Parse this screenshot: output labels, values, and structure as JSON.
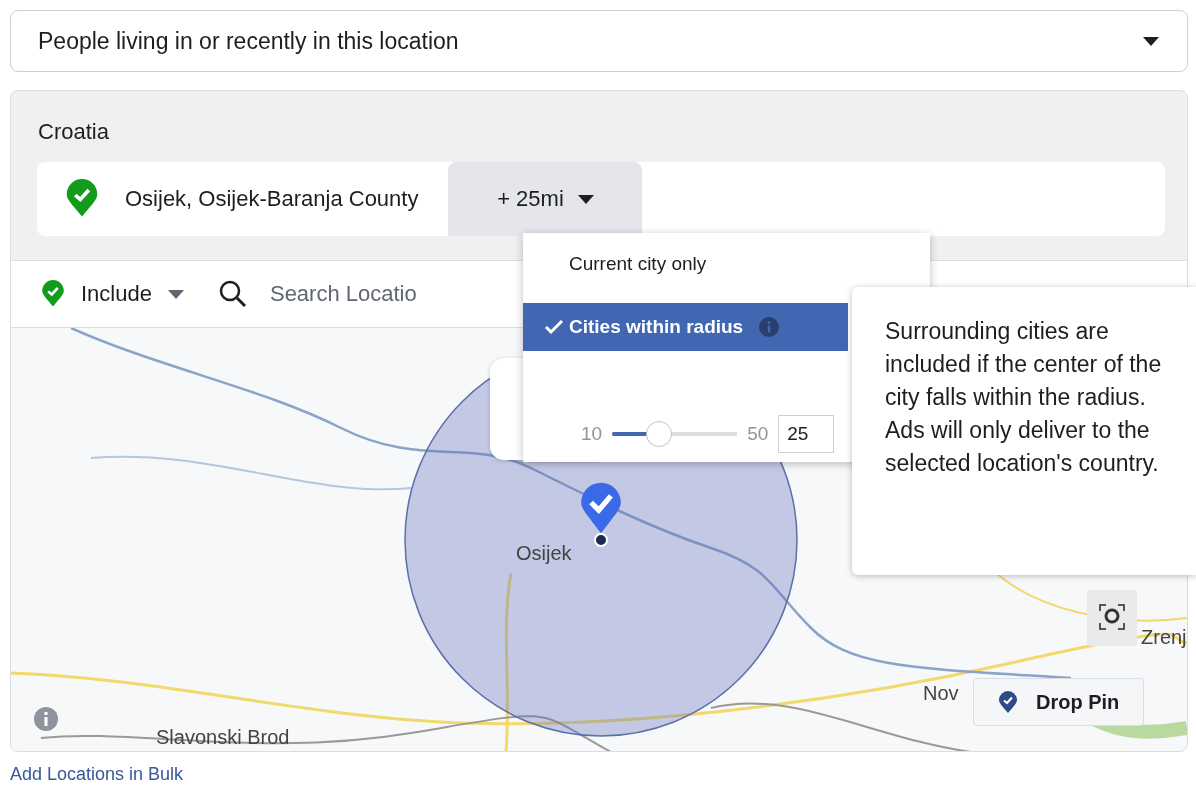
{
  "audience_select": {
    "value": "People living in or recently in this location"
  },
  "country": "Croatia",
  "location": {
    "name": "Osijek, Osijek-Baranja County",
    "radius": "+ 25mi"
  },
  "include": {
    "label": "Include"
  },
  "search": {
    "placeholder": "Search Locatio"
  },
  "radius_menu": {
    "options": [
      {
        "label": "Current city only",
        "selected": false
      },
      {
        "label": "Cities within radius",
        "selected": true
      }
    ],
    "slider": {
      "min": "10",
      "max": "50",
      "level": 0.375
    },
    "value": "25"
  },
  "tooltip": "Surrounding cities are included if the center of the city falls within the radius. Ads will only deliver to the selected location's country.",
  "map": {
    "labels": [
      {
        "text": "Osijek"
      },
      {
        "text": "Slavonski Brod"
      },
      {
        "text": "Nov"
      },
      {
        "text": "Zrenj"
      }
    ],
    "drop_pin": "Drop Pin"
  },
  "bulk_link": "Add Locations in Bulk"
}
